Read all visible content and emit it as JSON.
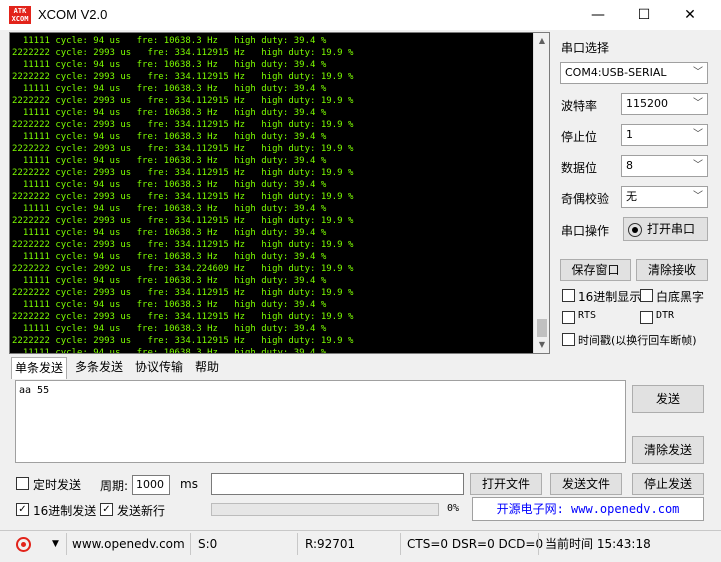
{
  "window": {
    "title": "XCOM V2.0",
    "logo_text": "ATK XCOM",
    "minimize": "—",
    "maximize": "☐",
    "close": "✕"
  },
  "terminal": {
    "lines": [
      "  11111 cycle: 94 us   fre: 10638.3 Hz   high duty: 39.4 %",
      "2222222 cycle: 2993 us   fre: 334.112915 Hz   high duty: 19.9 %",
      "  11111 cycle: 94 us   fre: 10638.3 Hz   high duty: 39.4 %",
      "2222222 cycle: 2993 us   fre: 334.112915 Hz   high duty: 19.9 %",
      "  11111 cycle: 94 us   fre: 10638.3 Hz   high duty: 39.4 %",
      "2222222 cycle: 2993 us   fre: 334.112915 Hz   high duty: 19.9 %",
      "  11111 cycle: 94 us   fre: 10638.3 Hz   high duty: 39.4 %",
      "2222222 cycle: 2993 us   fre: 334.112915 Hz   high duty: 19.9 %",
      "  11111 cycle: 94 us   fre: 10638.3 Hz   high duty: 39.4 %",
      "2222222 cycle: 2993 us   fre: 334.112915 Hz   high duty: 19.9 %",
      "  11111 cycle: 94 us   fre: 10638.3 Hz   high duty: 39.4 %",
      "2222222 cycle: 2993 us   fre: 334.112915 Hz   high duty: 19.9 %",
      "  11111 cycle: 94 us   fre: 10638.3 Hz   high duty: 39.4 %",
      "2222222 cycle: 2993 us   fre: 334.112915 Hz   high duty: 19.9 %",
      "  11111 cycle: 94 us   fre: 10638.3 Hz   high duty: 39.4 %",
      "2222222 cycle: 2993 us   fre: 334.112915 Hz   high duty: 19.9 %",
      "  11111 cycle: 94 us   fre: 10638.3 Hz   high duty: 39.4 %",
      "2222222 cycle: 2993 us   fre: 334.112915 Hz   high duty: 19.9 %",
      "  11111 cycle: 94 us   fre: 10638.3 Hz   high duty: 39.4 %",
      "2222222 cycle: 2992 us   fre: 334.224609 Hz   high duty: 19.9 %",
      "  11111 cycle: 94 us   fre: 10638.3 Hz   high duty: 39.4 %",
      "2222222 cycle: 2993 us   fre: 334.112915 Hz   high duty: 19.9 %",
      "  11111 cycle: 94 us   fre: 10638.3 Hz   high duty: 39.4 %",
      "2222222 cycle: 2993 us   fre: 334.112915 Hz   high duty: 19.9 %",
      "  11111 cycle: 94 us   fre: 10638.3 Hz   high duty: 39.4 %",
      "2222222 cycle: 2993 us   fre: 334.112915 Hz   high duty: 19.9 %",
      "  11111 cycle: 94 us   fre: 10638.3 Hz   high duty: 39.4 %",
      "2222222 cycle: 2993 us   fre: 334.1129"
    ],
    "text_color": "#7cfc00",
    "background": "#000000"
  },
  "serial": {
    "port_label": "串口选择",
    "port_value": "COM4:USB-SERIAL",
    "baud_label": "波特率",
    "baud_value": "115200",
    "stop_label": "停止位",
    "stop_value": "1",
    "data_label": "数据位",
    "data_value": "8",
    "parity_label": "奇偶校验",
    "parity_value": "无",
    "op_label": "串口操作",
    "open_button": "打开串口",
    "save_window": "保存窗口",
    "clear_recv": "清除接收",
    "hex_display": "16进制显示",
    "white_bg": "白底黑字",
    "rts": "RTS",
    "dtr": "DTR",
    "timestamp": "时间戳(以换行回车断帧)"
  },
  "tabs": [
    "单条发送",
    "多条发送",
    "协议传输",
    "帮助"
  ],
  "send": {
    "text": "aa 55",
    "send_button": "发送",
    "clear_send": "清除发送",
    "timed_send": "定时发送",
    "period_label": "周期:",
    "period_value": "1000",
    "period_unit": "ms",
    "open_file": "打开文件",
    "send_file": "发送文件",
    "stop_send": "停止发送",
    "hex_send": "16进制发送",
    "newline": "发送新行",
    "progress_text": "0%",
    "progress": 0,
    "link": "开源电子网: www.openedv.com"
  },
  "status": {
    "url": "www.openedv.com",
    "sent": "S:0",
    "recv": "R:92701",
    "lines": "CTS=0 DSR=0 DCD=0",
    "time": "当前时间 15:43:18"
  }
}
